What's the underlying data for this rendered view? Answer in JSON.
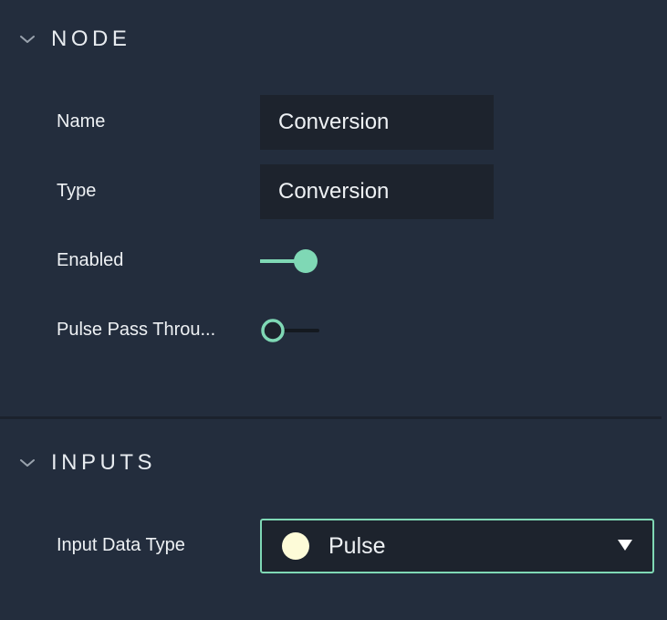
{
  "sections": {
    "node": {
      "title": "NODE",
      "expanded": true,
      "fields": {
        "name": {
          "label": "Name",
          "value": "Conversion"
        },
        "type": {
          "label": "Type",
          "value": "Conversion"
        },
        "enabled": {
          "label": "Enabled",
          "on": true
        },
        "pulse_pass_through": {
          "label": "Pulse Pass Throu...",
          "on": false
        }
      }
    },
    "inputs": {
      "title": "INPUTS",
      "expanded": true,
      "fields": {
        "input_data_type": {
          "label": "Input Data Type",
          "selected": "Pulse",
          "dot_color": "#fdfbd8"
        }
      }
    }
  },
  "icons": {
    "collapse": "chevron-down-icon",
    "dropdown": "caret-down-icon"
  },
  "colors": {
    "background": "#232d3d",
    "field_background": "#1d232d",
    "accent": "#7fd8b5",
    "text": "#eef1f4"
  }
}
